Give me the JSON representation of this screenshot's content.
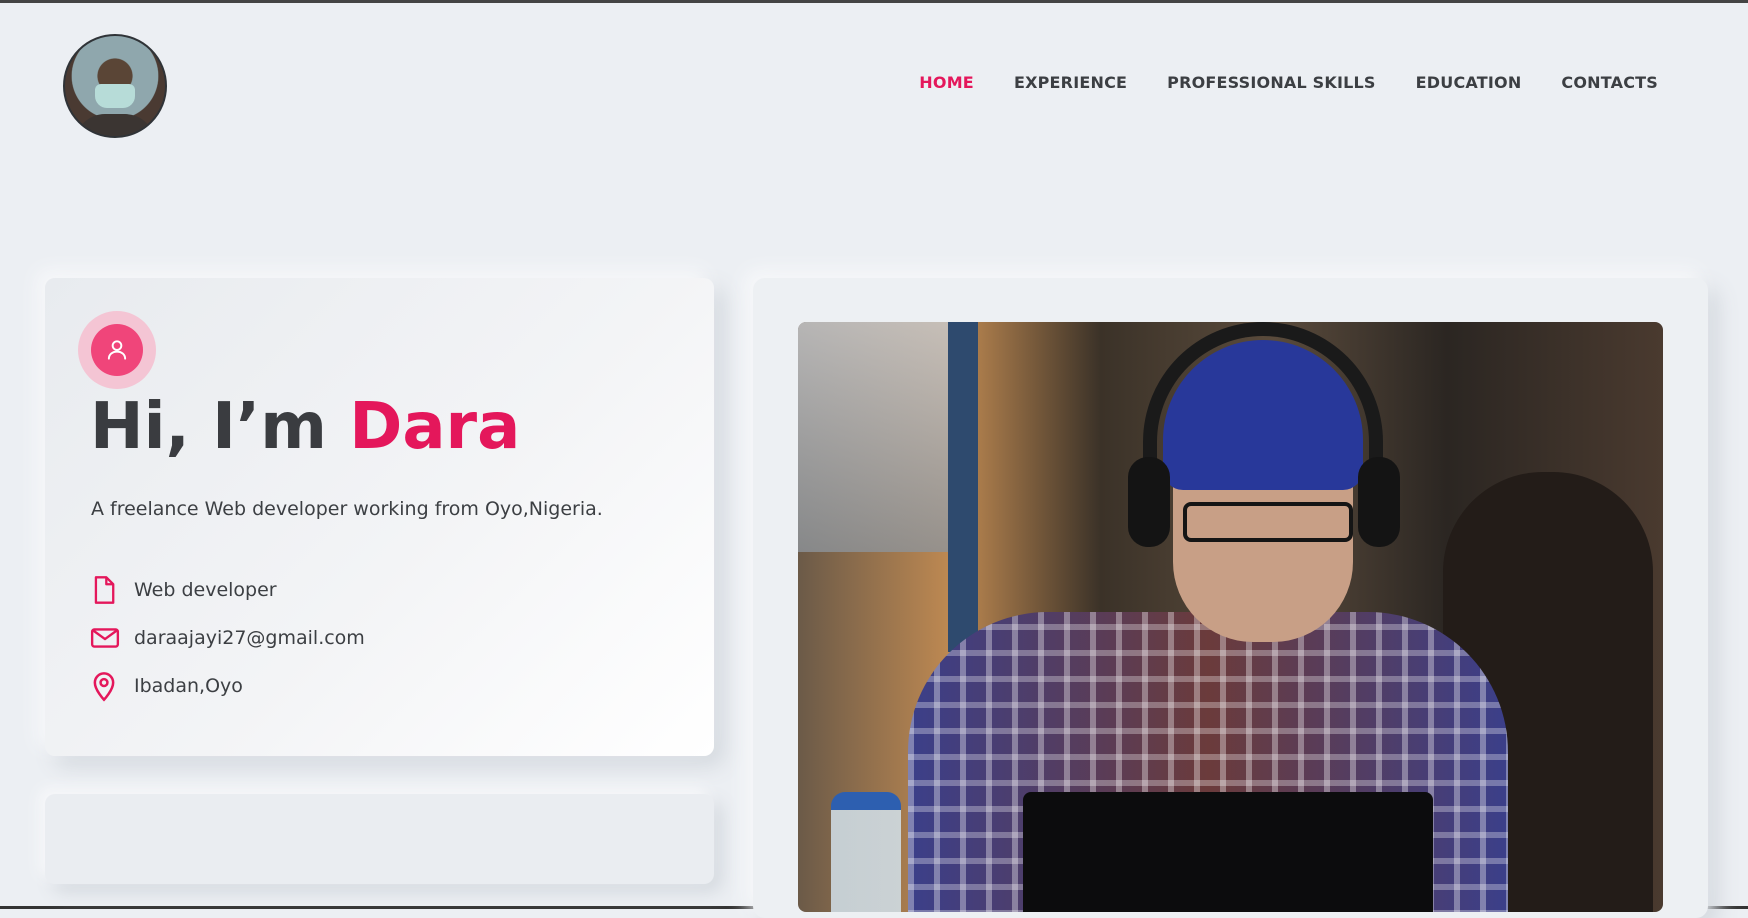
{
  "nav": {
    "items": [
      {
        "label": "HOME",
        "active": true
      },
      {
        "label": "EXPERIENCE",
        "active": false
      },
      {
        "label": "PROFESSIONAL SKILLS",
        "active": false
      },
      {
        "label": "EDUCATION",
        "active": false
      },
      {
        "label": "CONTACTS",
        "active": false
      }
    ]
  },
  "hero": {
    "greeting": "Hi, I’m",
    "name": "Dara",
    "tagline": "A freelance Web developer working from Oyo,Nigeria.",
    "details": [
      {
        "icon": "document-icon",
        "text": "Web developer"
      },
      {
        "icon": "mail-icon",
        "text": "daraajayi27@gmail.com"
      },
      {
        "icon": "location-pin-icon",
        "text": "Ibadan,Oyo"
      }
    ]
  },
  "colors": {
    "accent": "#e4175b",
    "background": "#eceff3",
    "text": "#3c3f43"
  }
}
